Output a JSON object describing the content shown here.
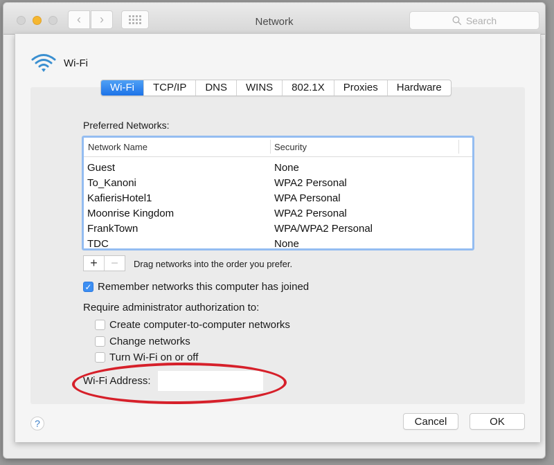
{
  "window": {
    "title": "Network",
    "search_placeholder": "Search",
    "nav_back_glyph": "‹",
    "nav_forward_glyph": "›"
  },
  "header": {
    "icon": "wifi-icon",
    "label": "Wi-Fi"
  },
  "tabs": [
    {
      "label": "Wi-Fi",
      "active": true
    },
    {
      "label": "TCP/IP",
      "active": false
    },
    {
      "label": "DNS",
      "active": false
    },
    {
      "label": "WINS",
      "active": false
    },
    {
      "label": "802.1X",
      "active": false
    },
    {
      "label": "Proxies",
      "active": false
    },
    {
      "label": "Hardware",
      "active": false
    }
  ],
  "preferred_networks": {
    "label": "Preferred Networks:",
    "columns": [
      "Network Name",
      "Security"
    ],
    "rows": [
      {
        "name": "Guest",
        "security": "None"
      },
      {
        "name": "To_Kanoni",
        "security": "WPA2 Personal"
      },
      {
        "name": "KafierisHotel1",
        "security": "WPA Personal"
      },
      {
        "name": "Moonrise Kingdom",
        "security": "WPA2 Personal"
      },
      {
        "name": "FrankTown",
        "security": "WPA/WPA2 Personal"
      },
      {
        "name": "TDC",
        "security": "None"
      }
    ],
    "add_glyph": "+",
    "remove_glyph": "−",
    "drag_hint": "Drag networks into the order you prefer."
  },
  "options": {
    "remember": {
      "label": "Remember networks this computer has joined",
      "checked": true
    },
    "require_label": "Require administrator authorization to:",
    "admin": [
      {
        "label": "Create computer-to-computer networks",
        "checked": false
      },
      {
        "label": "Change networks",
        "checked": false
      },
      {
        "label": "Turn Wi-Fi on or off",
        "checked": false
      }
    ]
  },
  "address": {
    "label": "Wi-Fi Address:",
    "value": ""
  },
  "annotation": {
    "color": "#d6202a",
    "shape": "ellipse around Wi-Fi Address"
  },
  "footer": {
    "help_glyph": "?",
    "cancel_label": "Cancel",
    "ok_label": "OK"
  },
  "colors": {
    "accent": "#1c73e8",
    "table_focus": "#94bdf1",
    "minimize": "#f5b731"
  }
}
